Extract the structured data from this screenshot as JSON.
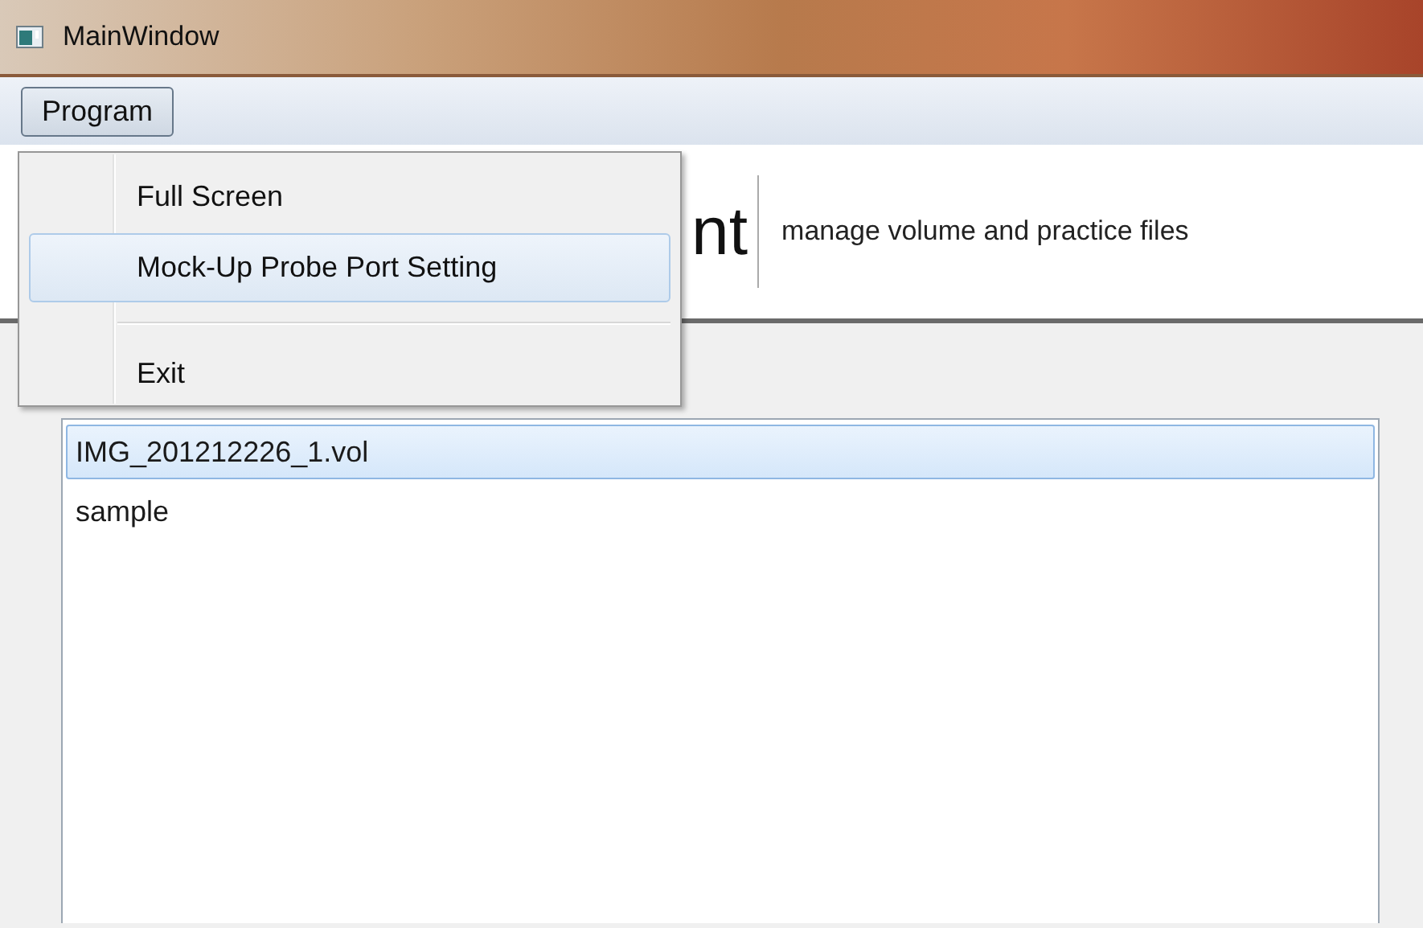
{
  "window": {
    "title": "MainWindow"
  },
  "menubar": [
    {
      "label": "Program",
      "selected": true
    }
  ],
  "menu": {
    "items": [
      {
        "kind": "item",
        "label": "Full Screen",
        "selected": false
      },
      {
        "kind": "item",
        "label": "Mock-Up Probe Port Setting",
        "selected": true
      },
      {
        "kind": "separator"
      },
      {
        "kind": "item",
        "label": "Exit",
        "selected": false
      }
    ]
  },
  "header": {
    "title": "nt",
    "subtitle": "manage volume and practice files"
  },
  "file_list": {
    "items": [
      {
        "label": "IMG_201212226_1.vol",
        "selected": true
      },
      {
        "label": "sample",
        "selected": false
      }
    ]
  }
}
